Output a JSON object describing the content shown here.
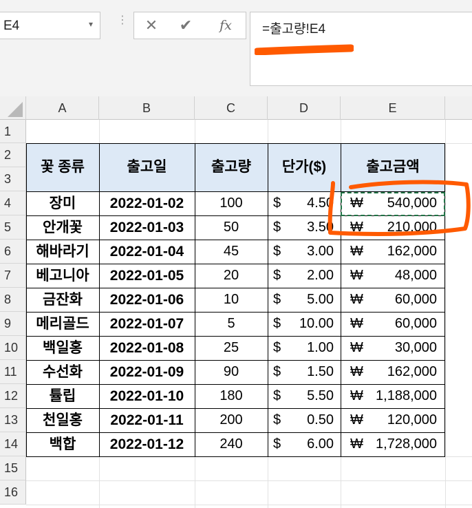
{
  "formula_bar": {
    "name_box": "E4",
    "name_box_caret": "▾",
    "separator": "⋮",
    "cancel_icon": "✕",
    "enter_icon": "✔",
    "function_icon": "fx",
    "formula": "=출고량!E4"
  },
  "columns": [
    "A",
    "B",
    "C",
    "D",
    "E"
  ],
  "row_numbers": [
    "1",
    "2",
    "3",
    "4",
    "5",
    "6",
    "7",
    "8",
    "9",
    "10",
    "11",
    "12",
    "13",
    "14",
    "15",
    "16"
  ],
  "table": {
    "headers": {
      "flower": "꽃 종류",
      "date": "출고일",
      "qty": "출고량",
      "price": "단가($)",
      "amount": "출고금액"
    },
    "rows": [
      {
        "flower": "장미",
        "date": "2022-01-02",
        "qty": "100",
        "cur": "$",
        "price": "4.50",
        "won": "₩",
        "amount": "540,000"
      },
      {
        "flower": "안개꽃",
        "date": "2022-01-03",
        "qty": "50",
        "cur": "$",
        "price": "3.50",
        "won": "₩",
        "amount": "210,000"
      },
      {
        "flower": "해바라기",
        "date": "2022-01-04",
        "qty": "45",
        "cur": "$",
        "price": "3.00",
        "won": "₩",
        "amount": "162,000"
      },
      {
        "flower": "베고니아",
        "date": "2022-01-05",
        "qty": "20",
        "cur": "$",
        "price": "2.00",
        "won": "₩",
        "amount": "48,000"
      },
      {
        "flower": "금잔화",
        "date": "2022-01-06",
        "qty": "10",
        "cur": "$",
        "price": "5.00",
        "won": "₩",
        "amount": "60,000"
      },
      {
        "flower": "메리골드",
        "date": "2022-01-07",
        "qty": "5",
        "cur": "$",
        "price": "10.00",
        "won": "₩",
        "amount": "60,000"
      },
      {
        "flower": "백일홍",
        "date": "2022-01-08",
        "qty": "25",
        "cur": "$",
        "price": "1.00",
        "won": "₩",
        "amount": "30,000"
      },
      {
        "flower": "수선화",
        "date": "2022-01-09",
        "qty": "90",
        "cur": "$",
        "price": "1.50",
        "won": "₩",
        "amount": "162,000"
      },
      {
        "flower": "튤립",
        "date": "2022-01-10",
        "qty": "180",
        "cur": "$",
        "price": "5.50",
        "won": "₩",
        "amount": "1,188,000"
      },
      {
        "flower": "천일홍",
        "date": "2022-01-11",
        "qty": "200",
        "cur": "$",
        "price": "0.50",
        "won": "₩",
        "amount": "120,000"
      },
      {
        "flower": "백합",
        "date": "2022-01-12",
        "qty": "240",
        "cur": "$",
        "price": "6.00",
        "won": "₩",
        "amount": "1,728,000"
      }
    ]
  },
  "colors": {
    "header_fill": "#dde9f6",
    "annotation": "#ff5a00",
    "selection": "#217346"
  }
}
